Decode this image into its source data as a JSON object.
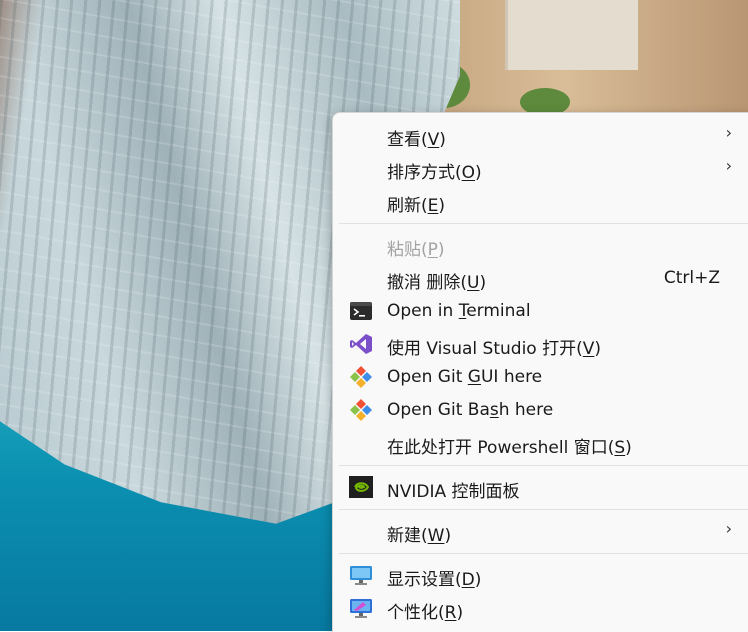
{
  "menu": {
    "items": [
      {
        "pre": "查看(",
        "key": "V",
        "post": ")",
        "submenu": true
      },
      {
        "pre": "排序方式(",
        "key": "O",
        "post": ")",
        "submenu": true
      },
      {
        "pre": "刷新(",
        "key": "E",
        "post": ")"
      },
      {
        "pre": "粘贴(",
        "key": "P",
        "post": ")",
        "disabled": true
      },
      {
        "pre": "撤消 删除(",
        "key": "U",
        "post": ")",
        "shortcut": "Ctrl+Z"
      },
      {
        "pre": "Open in ",
        "key": "T",
        "post": "erminal",
        "icon": "terminal-icon"
      },
      {
        "pre": "使用 Visual Studio 打开(",
        "key": "V",
        "post": ")",
        "icon": "visual-studio-icon"
      },
      {
        "pre": "Open Git ",
        "key": "G",
        "post": "UI here",
        "icon": "git-icon"
      },
      {
        "pre": "Open Git Ba",
        "key": "s",
        "post": "h here",
        "icon": "git-icon"
      },
      {
        "pre": "在此处打开 Powershell 窗口(",
        "key": "S",
        "post": ")"
      },
      {
        "pre": "NVIDIA 控制面板",
        "key": "",
        "post": "",
        "icon": "nvidia-icon"
      },
      {
        "pre": "新建(",
        "key": "W",
        "post": ")",
        "submenu": true
      },
      {
        "pre": "显示设置(",
        "key": "D",
        "post": ")",
        "icon": "display-settings-icon"
      },
      {
        "pre": "个性化(",
        "key": "R",
        "post": ")",
        "icon": "personalize-icon"
      }
    ],
    "submenu_glyph": "›"
  },
  "colors": {
    "menu_bg": "#f9f9f9",
    "text": "#1a1a1a",
    "disabled_text": "#a3a3a3",
    "separator": "#e1e1e1"
  }
}
